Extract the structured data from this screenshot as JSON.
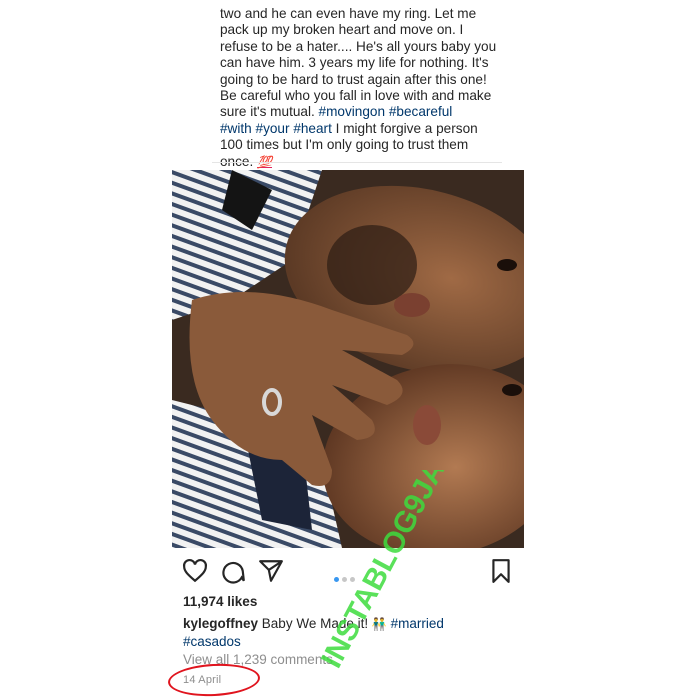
{
  "caption_top": {
    "lines": [
      "two and he can even have my ring. Let me",
      "pack up my broken heart and move on. I",
      "refuse to be a hater.... He's all yours baby you",
      "can have him. 3 years my life for nothing. It's",
      "going to be hard to trust again after this one!",
      "Be careful who you fall in love with and make",
      "sure it's mutual.",
      "I might forgive a person",
      "100 times but I'm only going to trust them",
      "once."
    ],
    "hashtags": [
      "#movingon",
      "#becareful",
      "#with",
      "#your",
      "#heart"
    ],
    "emoji": "💯"
  },
  "post": {
    "likes": "11,974 likes",
    "username": "kylegoffney",
    "caption_text": "Baby We Made it!",
    "caption_emoji": "👬",
    "caption_tags": [
      "#married",
      "#casados"
    ],
    "comments_text": "View all 1,239 comments",
    "date": "14 April",
    "carousel": {
      "count": 3,
      "active": 1
    }
  },
  "icons": {
    "like": "heart-icon",
    "comment": "comment-icon",
    "share": "send-icon",
    "save": "bookmark-icon"
  },
  "watermark": {
    "text": "INSTABLOG9JA",
    "color": "#3ddc3d"
  },
  "colors": {
    "annotation_circle": "#e0141e",
    "hashtag": "#00376b",
    "active_dot": "#3897f0"
  }
}
